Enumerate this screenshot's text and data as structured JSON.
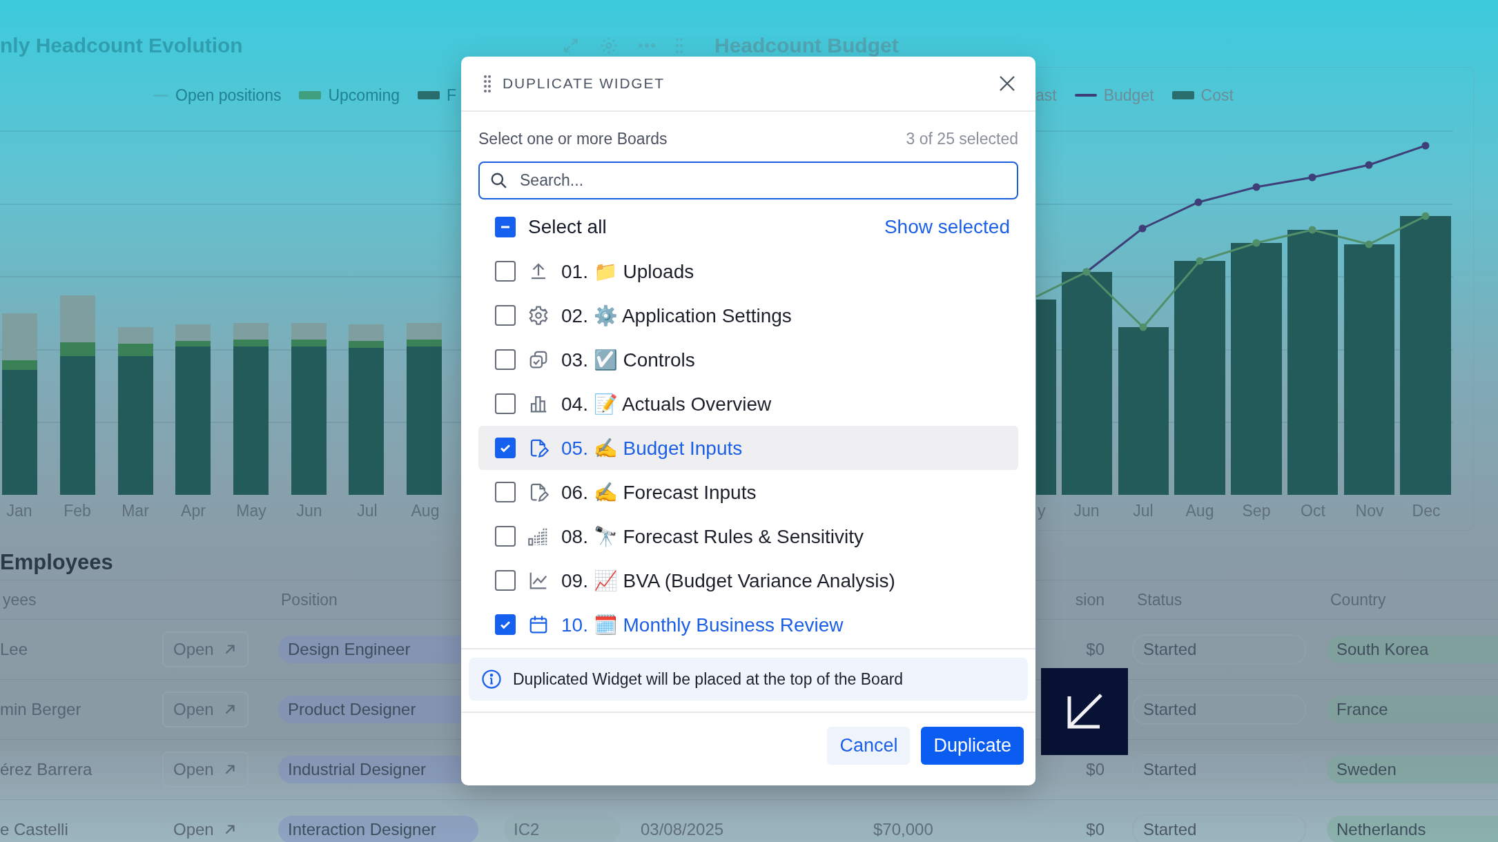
{
  "left_panel": {
    "title": "nly Headcount Evolution",
    "legend": [
      {
        "label": "Open positions",
        "kind": "dash"
      },
      {
        "label": "Upcoming",
        "kind": "green"
      },
      {
        "label": "F",
        "kind": "teal"
      }
    ],
    "months": [
      "Jan",
      "Feb",
      "Mar",
      "Apr",
      "May",
      "Jun",
      "Jul",
      "Aug"
    ]
  },
  "right_panel": {
    "title": "Headcount Budget",
    "legend": [
      {
        "label": "ast",
        "kind": "cut"
      },
      {
        "label": "Budget",
        "kind": "line"
      },
      {
        "label": "Cost",
        "kind": "teal"
      }
    ],
    "months": [
      "y",
      "Jun",
      "Jul",
      "Aug",
      "Sep",
      "Oct",
      "Nov",
      "Dec"
    ]
  },
  "employees": {
    "title": "Employees",
    "header": {
      "name": "yees",
      "position": "Position",
      "column_7": "sion",
      "status": "Status",
      "country": "Country"
    },
    "rows": [
      {
        "name": "Lee",
        "open": "Open",
        "position": "Design Engineer",
        "column_7": "$0",
        "status": "Started",
        "country": "South Korea"
      },
      {
        "name": "min Berger",
        "open": "Open",
        "position": "Product Designer",
        "status": "Started",
        "country": "France"
      },
      {
        "name": "érez Barrera",
        "open": "Open",
        "position": "Industrial Designer",
        "column_7": "$0",
        "status": "Started",
        "country": "Sweden"
      },
      {
        "name": "e Castelli",
        "open": "Open",
        "position": "Interaction Designer",
        "column_4": "IC2",
        "column_5": "03/08/2025",
        "column_6": "$70,000",
        "column_7": "$0",
        "status": "Started",
        "country": "Netherlands"
      }
    ]
  },
  "modal": {
    "title": "DUPLICATE WIDGET",
    "prompt": "Select one or more Boards",
    "count": "3 of 25 selected",
    "search": {
      "placeholder": "Search..."
    },
    "select_all": {
      "label": "Select all",
      "indeterminate": true
    },
    "show_selected": "Show selected",
    "boards": [
      {
        "label": "01. 📁 Uploads",
        "kind": "upload",
        "checked": false,
        "hovered": false
      },
      {
        "label": "02. ⚙️ Application Settings",
        "kind": "gear",
        "checked": false,
        "hovered": false
      },
      {
        "label": "03. ☑️ Controls",
        "kind": "copy",
        "checked": false,
        "hovered": false
      },
      {
        "label": "04. 📝 Actuals Overview",
        "kind": "bars",
        "checked": false,
        "hovered": false
      },
      {
        "label": "05. ✍️ Budget Inputs",
        "kind": "file-edit",
        "checked": true,
        "hovered": true
      },
      {
        "label": "06. ✍️ Forecast Inputs",
        "kind": "file-edit",
        "checked": false,
        "hovered": false
      },
      {
        "label": "08. 🔭 Forecast Rules & Sensitivity",
        "kind": "columns",
        "checked": false,
        "hovered": false
      },
      {
        "label": "09. 📈 BVA (Budget Variance Analysis)",
        "kind": "line-chart",
        "checked": false,
        "hovered": false
      },
      {
        "label": "10. 🗓️ Monthly Business Review",
        "kind": "calendar",
        "checked": true,
        "hovered": false
      }
    ],
    "info": "Duplicated Widget will be placed at the top of the Board",
    "buttons": [
      {
        "label": "Cancel",
        "kind": "secondary"
      },
      {
        "label": "Duplicate",
        "kind": "primary"
      }
    ]
  }
}
